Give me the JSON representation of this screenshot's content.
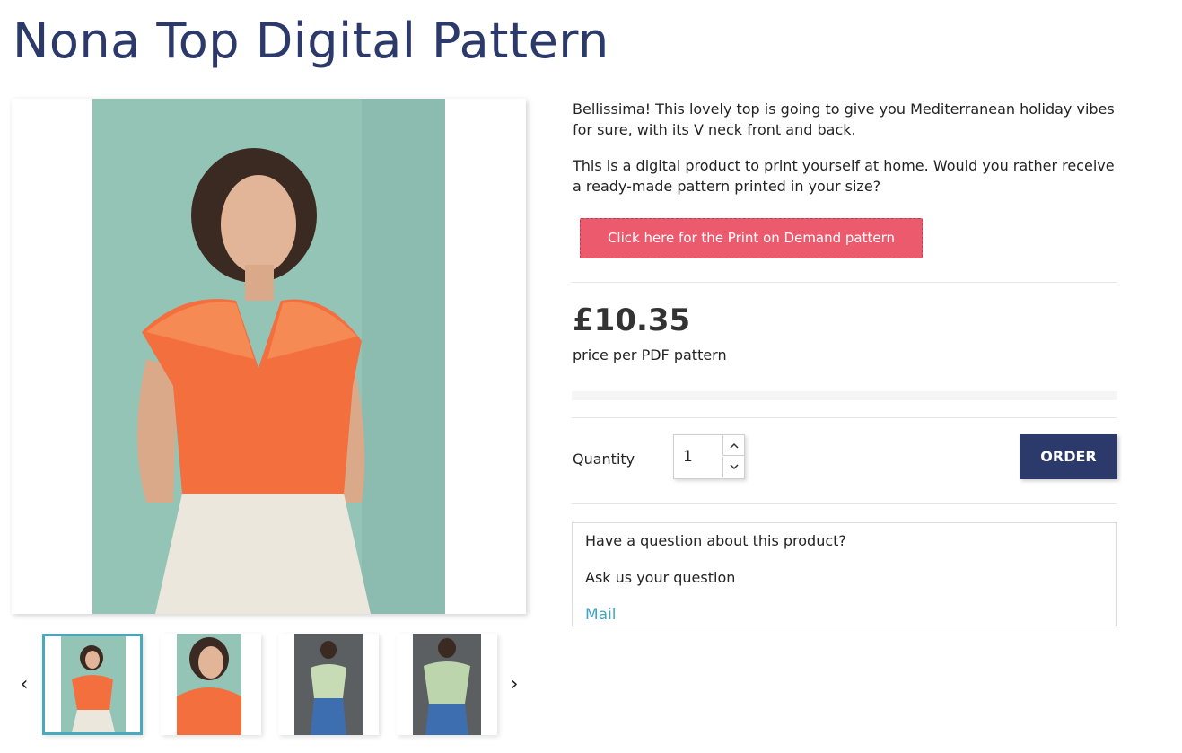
{
  "product": {
    "title": "Nona Top Digital Pattern",
    "description_1": "Bellissima! This lovely top is going to give you Mediterranean holiday vibes for sure, with its V neck front and back.",
    "description_2": "This is a digital product to print yourself at home. Would you rather receive a ready-made pattern printed in your size?",
    "print_on_demand_label": "Click here for the Print on Demand pattern",
    "price": "£10.35",
    "price_note": "price per PDF pattern"
  },
  "purchase": {
    "quantity_label": "Quantity",
    "quantity_value": "1",
    "order_label": "ORDER"
  },
  "question": {
    "title": "Have a question about this product?",
    "ask": "Ask us your question",
    "mail_label": "Mail"
  },
  "gallery": {
    "prev_icon": "‹",
    "next_icon": "›",
    "thumbnails": [
      {
        "name": "orange-top-front",
        "selected": true
      },
      {
        "name": "orange-top-closeup",
        "selected": false
      },
      {
        "name": "green-top-front",
        "selected": false
      },
      {
        "name": "green-top-back",
        "selected": false
      }
    ]
  },
  "colors": {
    "title": "#2c3a6b",
    "order_button": "#2c3a6b",
    "pod_button": "#ec5b6d",
    "link": "#3ea6c2",
    "thumb_selected_border": "#49a9bd"
  }
}
